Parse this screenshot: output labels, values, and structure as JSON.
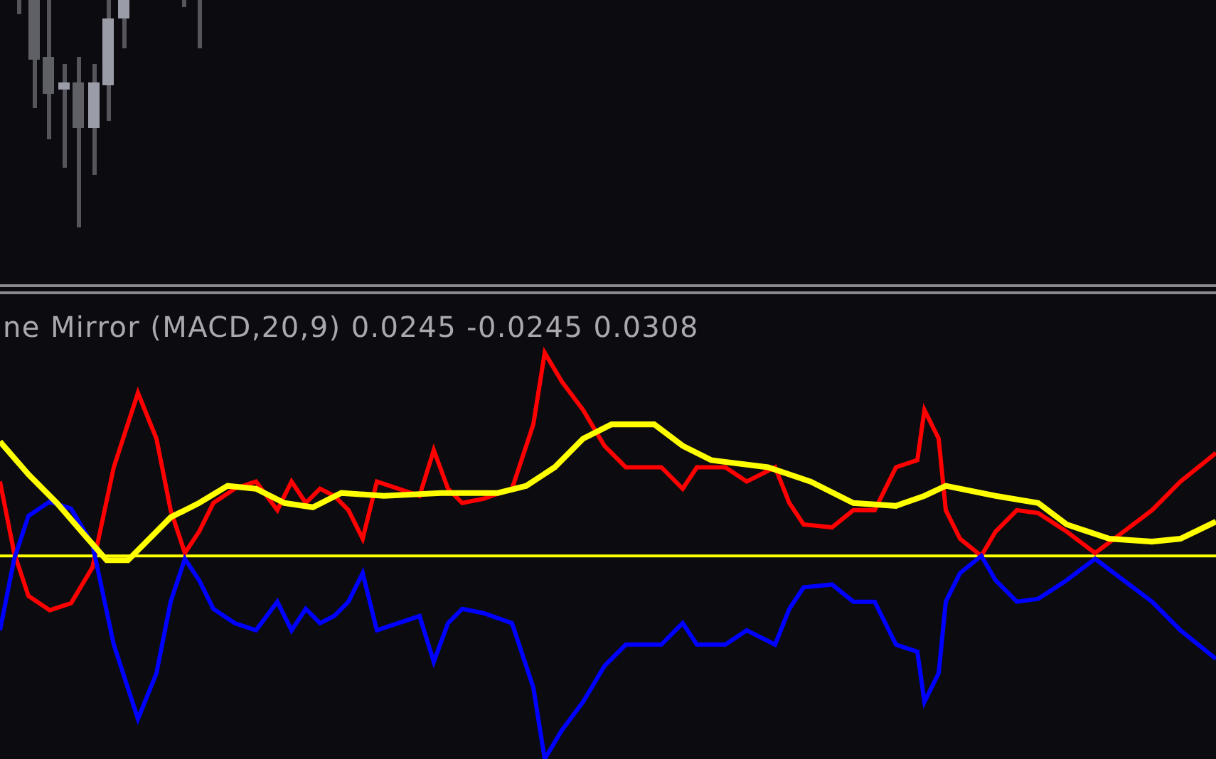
{
  "indicator": {
    "label": "ne Mirror (MACD,20,9) 0.0245 -0.0245 0.0308"
  }
}
